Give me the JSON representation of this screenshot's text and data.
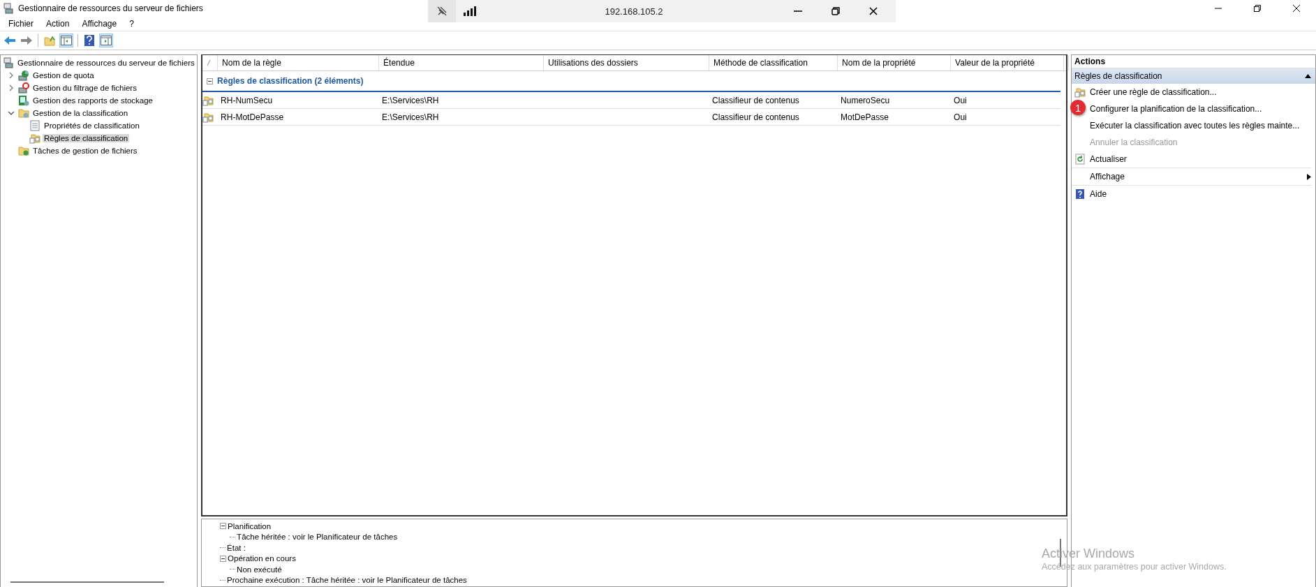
{
  "window": {
    "title": "Gestionnaire de ressources du serveur de fichiers"
  },
  "remote_bar": {
    "address": "192.168.105.2"
  },
  "menu": [
    "Fichier",
    "Action",
    "Affichage",
    "?"
  ],
  "tree": {
    "label": "Gestionnaire de ressources du serveur de fichiers",
    "kind": "server",
    "selected": false,
    "children": [
      {
        "label": "Gestion de quota",
        "kind": "quota",
        "expanded": false,
        "selected": false
      },
      {
        "label": "Gestion du filtrage de fichiers",
        "kind": "filter",
        "expanded": false,
        "selected": false
      },
      {
        "label": "Gestion des rapports de stockage",
        "kind": "report",
        "selected": false
      },
      {
        "label": "Gestion de la classification",
        "kind": "folder",
        "expanded": true,
        "selected": false,
        "children": [
          {
            "label": "Propriétés de classification",
            "kind": "properties",
            "selected": false
          },
          {
            "label": "Règles de classification",
            "kind": "rules",
            "selected": true
          }
        ]
      },
      {
        "label": "Tâches de gestion de fichiers",
        "kind": "tasks",
        "selected": false
      }
    ]
  },
  "table": {
    "columns": [
      "Nom de la règle",
      "Étendue",
      "Utilisations des dossiers",
      "Méthode de classification",
      "Nom de la propriété",
      "Valeur de la propriété"
    ],
    "group": {
      "label": "Règles de classification (2 éléments)",
      "expanded": true
    },
    "rows": [
      {
        "name": "RH-NumSecu",
        "scope": "E:\\Services\\RH",
        "method": "Classifieur de contenus",
        "property": "NumeroSecu",
        "value": "Oui",
        "selected": false
      },
      {
        "name": "RH-MotDePasse",
        "scope": "E:\\Services\\RH",
        "method": "Classifieur de contenus",
        "property": "MotDePasse",
        "value": "Oui",
        "selected": false
      }
    ]
  },
  "details": [
    {
      "label": "Planification",
      "expanded": true,
      "children": [
        {
          "label": "Tâche héritée : voir le Planificateur de tâches"
        }
      ]
    },
    {
      "label": "État :"
    },
    {
      "label": "Opération en cours",
      "expanded": true,
      "children": [
        {
          "label": "Non exécuté"
        }
      ]
    },
    {
      "label": "Prochaine exécution : Tâche héritée : voir le Planificateur de tâches"
    }
  ],
  "actions": {
    "title": "Actions",
    "section": {
      "label": "Règles de classification",
      "expanded": true
    },
    "items": [
      {
        "label": "Créer une règle de classification...",
        "kind": "rules",
        "disabled": false
      },
      {
        "label": "Configurer la planification de la classification...",
        "kind": "plain",
        "disabled": false,
        "badge": "1"
      },
      {
        "label": "Exécuter la classification avec toutes les règles mainte...",
        "kind": "plain",
        "disabled": false
      },
      {
        "label": "Annuler la classification",
        "kind": "plain",
        "disabled": true
      },
      {
        "label": "Actualiser",
        "kind": "refresh",
        "disabled": false
      },
      {
        "label": "Affichage",
        "kind": "submenu",
        "disabled": false
      },
      {
        "label": "Aide",
        "kind": "help",
        "disabled": false
      }
    ]
  },
  "activation_notice": {
    "title": "Activer Windows",
    "text": "Accédez aux paramètres pour activer Windows."
  }
}
